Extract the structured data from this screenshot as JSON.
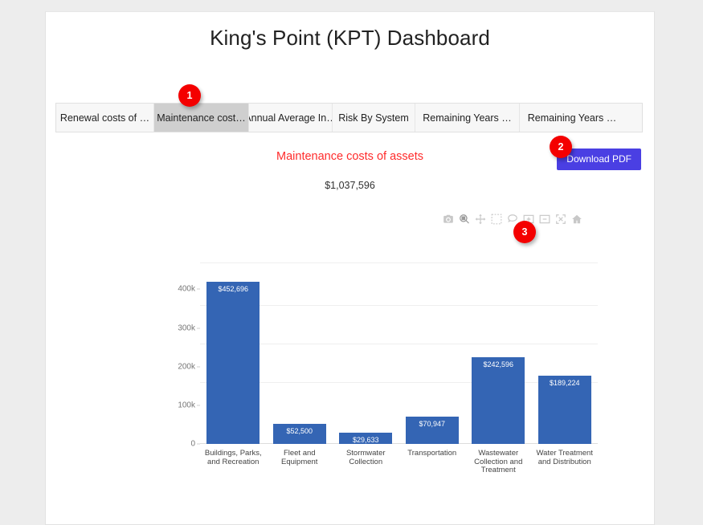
{
  "header": {
    "title": "King's Point (KPT) Dashboard"
  },
  "tabs": [
    {
      "label": "Renewal costs of …",
      "active": false
    },
    {
      "label": "Maintenance cost…",
      "active": true
    },
    {
      "label": "Annual Average In…",
      "active": false
    },
    {
      "label": "Risk By System",
      "active": false
    },
    {
      "label": "Remaining Years …",
      "active": false
    },
    {
      "label": "Remaining Years …",
      "active": false
    }
  ],
  "toolbar": {
    "download_label": "Download PDF",
    "download_color": "#4a3fe3"
  },
  "modebar": {
    "buttons": [
      "camera-icon",
      "zoom-icon",
      "pan-icon",
      "box-select-icon",
      "lasso-select-icon",
      "zoom-in-icon",
      "zoom-out-icon",
      "autoscale-icon",
      "reset-axes-home-icon"
    ]
  },
  "annotations": [
    {
      "number": "1",
      "target": "tab-maintenance-costs"
    },
    {
      "number": "2",
      "target": "download-pdf-button"
    },
    {
      "number": "3",
      "target": "chart-plot-area"
    }
  ],
  "chart_data": {
    "type": "bar",
    "title": "Maintenance costs of assets",
    "subtitle": "$1,037,596",
    "title_color": "#ff2b2b",
    "bar_color": "#3465b4",
    "xlabel": "",
    "ylabel": "",
    "ylim": [
      0,
      470000
    ],
    "grid": true,
    "legend": "none",
    "ytick_labels": [
      "0",
      "100k",
      "200k",
      "300k",
      "400k"
    ],
    "ytick_values": [
      0,
      100000,
      200000,
      300000,
      400000
    ],
    "categories": [
      "Buildings, Parks, and Recreation",
      "Fleet and Equipment",
      "Stormwater Collection",
      "Transportation",
      "Wastewater Collection and Treatment",
      "Water Treatment and Distribution"
    ],
    "values": [
      452696,
      52500,
      29633,
      70947,
      242596,
      189224
    ],
    "data_labels": [
      "$452,696",
      "$52,500",
      "$29,633",
      "$70,947",
      "$242,596",
      "$189,224"
    ]
  }
}
